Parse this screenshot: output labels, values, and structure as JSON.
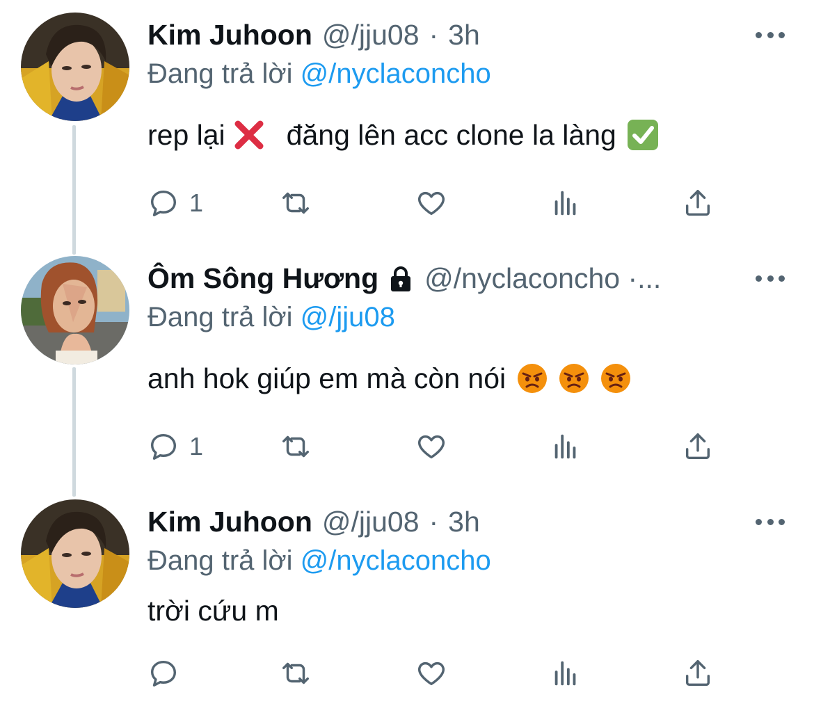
{
  "thread": {
    "tweets": [
      {
        "display_name": "Kim Juhoon",
        "handle": "@/jju08",
        "separator": "·",
        "time": "3h",
        "locked": false,
        "reply_prefix": "Đang trả lời",
        "reply_to": "@/nyclaconcho",
        "content_before": "rep lại",
        "content_after": "đăng lên acc clone la làng",
        "emojis": [
          "cross-mark-icon",
          "check-mark-button-icon"
        ],
        "reply_count": "1",
        "avatar_icon": "profile-photo"
      },
      {
        "display_name": "Ôm Sông Hương",
        "handle": "@/nyclaconcho ·...",
        "locked": true,
        "lock_icon": "lock-icon",
        "reply_prefix": "Đang trả lời",
        "reply_to": "@/jju08",
        "content": "anh hok giúp em mà còn nói",
        "emojis": [
          "angry-face-icon",
          "angry-face-icon",
          "angry-face-icon"
        ],
        "reply_count": "1",
        "avatar_icon": "profile-photo"
      },
      {
        "display_name": "Kim Juhoon",
        "handle": "@/jju08",
        "separator": "·",
        "time": "3h",
        "locked": false,
        "reply_prefix": "Đang trả lời",
        "reply_to": "@/nyclaconcho",
        "content": "trời cứu m",
        "reply_count": "",
        "avatar_icon": "profile-photo"
      }
    ],
    "action_icons": [
      "reply-icon",
      "retweet-icon",
      "like-icon",
      "views-icon",
      "share-icon"
    ],
    "more_icon": "more-options-icon"
  },
  "colors": {
    "text_primary": "#0f1419",
    "text_secondary": "#536471",
    "link": "#1d9bf0",
    "thread_line": "#cfd9de"
  }
}
